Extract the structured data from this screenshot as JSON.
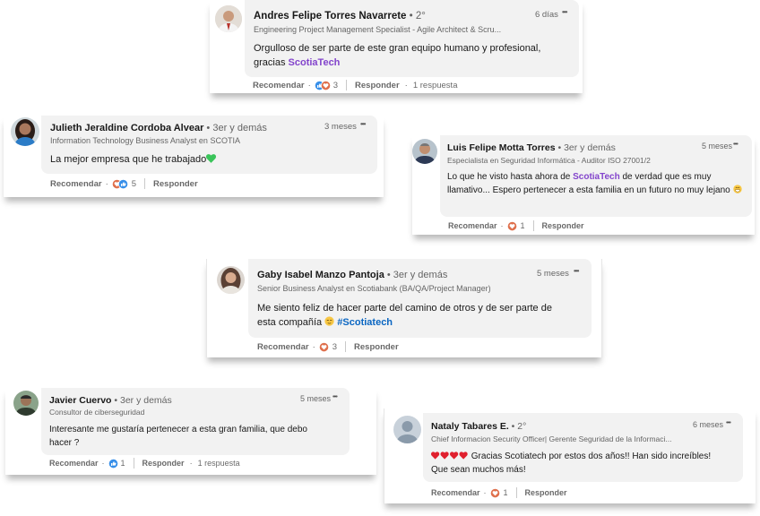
{
  "comments": [
    {
      "name": "Andres Felipe Torres Navarrete",
      "degree": " • 2°",
      "headline": "Engineering Project Management Specialist - Agile Architect & Scru...",
      "time": "6 días",
      "more": "•••",
      "body": "Orgulloso de ser parte de este gran equipo humano y profesional,",
      "body2": "gracias ",
      "mention": "ScotiaTech",
      "react_label": "Recomendar",
      "reaction_icons": [
        "like-icon",
        "love-icon"
      ],
      "reaction_count": "3",
      "reply_label": "Responder",
      "replies": "1 respuesta"
    },
    {
      "name": "Julieth Jeraldine Cordoba Alvear",
      "degree": " • 3er y demás",
      "headline": "Information Technology Business Analyst en SCOTIA",
      "time": "3 meses",
      "more": "•••",
      "body": "La mejor empresa que he trabajado",
      "emoji": "green-heart",
      "react_label": "Recomendar",
      "reaction_icons": [
        "love-icon",
        "like-icon"
      ],
      "reaction_count": "5",
      "reply_label": "Responder"
    },
    {
      "name": "Luis Felipe Motta Torres",
      "degree": " • 3er y demás",
      "headline": "Especialista en Seguridad Informática - Auditor ISO 27001/2",
      "time": "5 meses",
      "more": "•••",
      "body_a": "Lo que he visto hasta ahora de ",
      "mention": "ScotiaTech",
      "body_b": " de verdad que es muy llamativo... Espero pertenecer a esta familia en un futuro no muy lejano ",
      "emoji": "grin-emoji",
      "react_label": "Recomendar",
      "reaction_icons": [
        "love-icon"
      ],
      "reaction_count": "1",
      "reply_label": "Responder"
    },
    {
      "name": "Gaby Isabel Manzo Pantoja",
      "degree": " • 3er y demás",
      "headline": "Senior Business Analyst en Scotiabank (BA/QA/Project Manager)",
      "time": "5 meses",
      "more": "•••",
      "body": "Me siento feliz de hacer parte del camino de otros y de ser parte de",
      "body2": "esta compañía ",
      "emoji": "relieved-emoji",
      "hashtag": "#Scotiatech",
      "react_label": "Recomendar",
      "reaction_icons": [
        "love-icon"
      ],
      "reaction_count": "3",
      "reply_label": "Responder"
    },
    {
      "name": "Javier Cuervo",
      "degree": " • 3er y demás",
      "headline": "Consultor de ciberseguridad",
      "time": "5 meses",
      "more": "•••",
      "body": "Interesante me gustaría pertenecer a esta gran familia, que debo",
      "body2": "hacer ?",
      "react_label": "Recomendar",
      "reaction_icons": [
        "like-icon"
      ],
      "reaction_count": "1",
      "reply_label": "Responder",
      "replies": "1 respuesta"
    },
    {
      "name": "Nataly Tabares E.",
      "degree": " • 2°",
      "headline": "Chief Informacion Security Officer| Gerente Seguridad de la Informaci...",
      "time": "6 meses",
      "more": "•••",
      "emoji": "red-hearts",
      "body": " Gracias Scotiatech por estos dos años!! Han sido increíbles!",
      "body2": "Que sean muchos más!",
      "react_label": "Recomendar",
      "reaction_icons": [
        "love-icon"
      ],
      "reaction_count": "1",
      "reply_label": "Responder"
    }
  ],
  "colors": {
    "mention": "#8344cc",
    "hashtag": "#0a66c2",
    "like": "#378fe9",
    "love": "#df704d",
    "bubble": "#f2f2f2"
  }
}
